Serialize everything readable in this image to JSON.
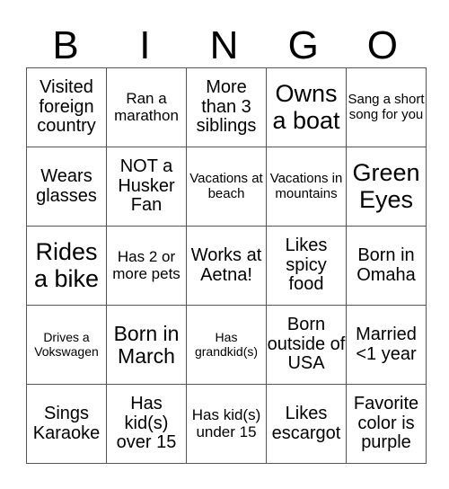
{
  "title_letters": [
    "B",
    "I",
    "N",
    "G",
    "O"
  ],
  "rows": [
    [
      {
        "text": "Visited foreign country",
        "size": "s-m"
      },
      {
        "text": "Ran a marathon",
        "size": "s-s"
      },
      {
        "text": "More than 3 siblings",
        "size": "s-m"
      },
      {
        "text": "Owns a boat",
        "size": "s-xl"
      },
      {
        "text": "Sang a short song for you",
        "size": "s-xs"
      }
    ],
    [
      {
        "text": "Wears glasses",
        "size": "s-m"
      },
      {
        "text": "NOT a Husker Fan",
        "size": "s-m"
      },
      {
        "text": "Vacations at beach",
        "size": "s-xs"
      },
      {
        "text": "Vacations in mountains",
        "size": "s-xs"
      },
      {
        "text": "Green Eyes",
        "size": "s-xl"
      }
    ],
    [
      {
        "text": "Rides a bike",
        "size": "s-xl"
      },
      {
        "text": "Has 2 or more pets",
        "size": "s-s"
      },
      {
        "text": "Works at Aetna!",
        "size": "s-m"
      },
      {
        "text": "Likes spicy food",
        "size": "s-m"
      },
      {
        "text": "Born in Omaha",
        "size": "s-m"
      }
    ],
    [
      {
        "text": "Drives a Vokswagen",
        "size": "s-xxs"
      },
      {
        "text": "Born in March",
        "size": "s-l"
      },
      {
        "text": "Has grandkid(s)",
        "size": "s-xxs"
      },
      {
        "text": "Born outside of USA",
        "size": "s-m"
      },
      {
        "text": "Married <1 year",
        "size": "s-m"
      }
    ],
    [
      {
        "text": "Sings Karaoke",
        "size": "s-m"
      },
      {
        "text": "Has kid(s) over 15",
        "size": "s-m"
      },
      {
        "text": "Has kid(s) under 15",
        "size": "s-s"
      },
      {
        "text": "Likes escargot",
        "size": "s-m"
      },
      {
        "text": "Favorite color is purple",
        "size": "s-m"
      }
    ]
  ]
}
